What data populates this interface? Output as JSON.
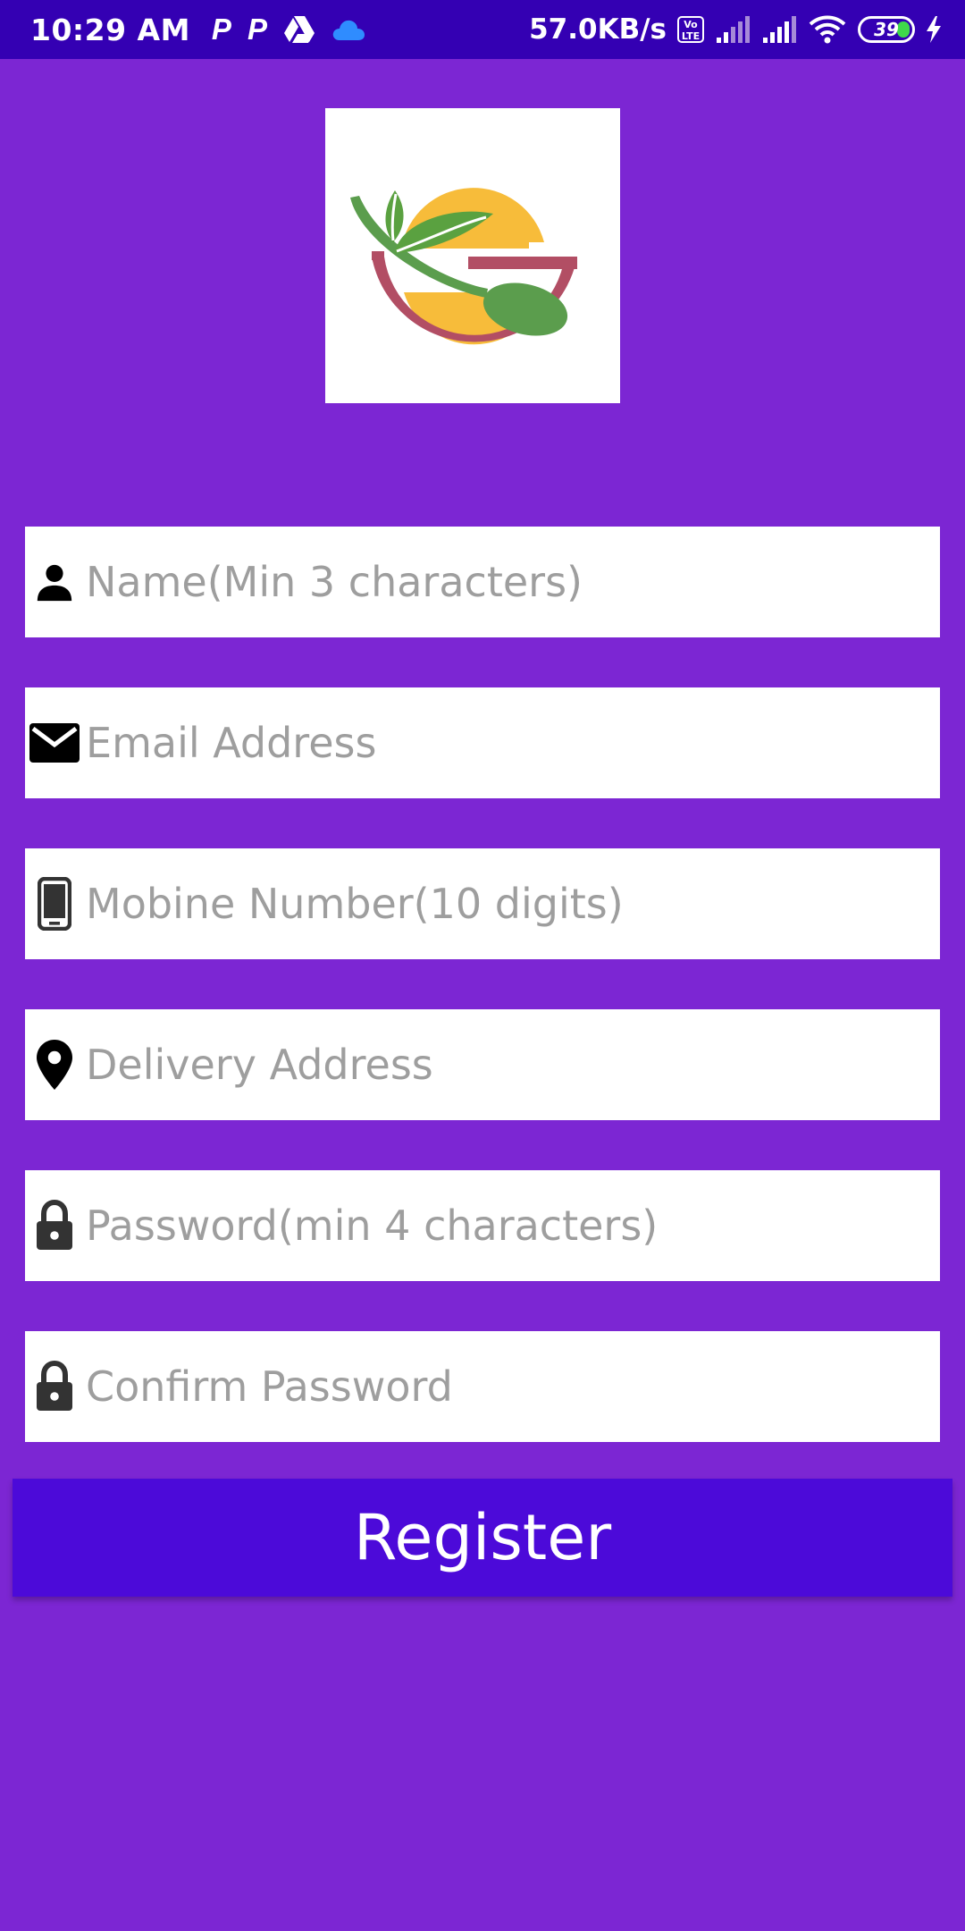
{
  "status_bar": {
    "time": "10:29 AM",
    "net_speed": "57.0KB/s",
    "volte_label": "Vo LTE",
    "battery_level": "39",
    "icons": [
      "p-app-icon",
      "p-app-icon",
      "drive-icon",
      "cloud-icon",
      "volte-icon",
      "signal-icon",
      "signal-icon",
      "wifi-icon",
      "battery-icon",
      "charging-icon"
    ]
  },
  "logo": {
    "colors": {
      "ring_top": "#f7bc3a",
      "bowl": "#b24e64",
      "leaf": "#5aa140",
      "spoon": "#5b9d4d"
    }
  },
  "form": {
    "fields": [
      {
        "icon": "person-icon",
        "placeholder": "Name(Min 3 characters)",
        "value": ""
      },
      {
        "icon": "email-icon",
        "placeholder": "Email Address",
        "value": ""
      },
      {
        "icon": "phone-icon",
        "placeholder": "Mobine Number(10 digits)",
        "value": ""
      },
      {
        "icon": "location-pin-icon",
        "placeholder": "Delivery Address",
        "value": ""
      },
      {
        "icon": "lock-icon",
        "placeholder": "Password(min 4 characters)",
        "value": ""
      },
      {
        "icon": "lock-icon",
        "placeholder": "Confirm Password",
        "value": ""
      }
    ],
    "register_label": "Register"
  },
  "colors": {
    "background": "#7c26d3",
    "status_bar": "#3400b3",
    "button": "#4c0ad9"
  }
}
